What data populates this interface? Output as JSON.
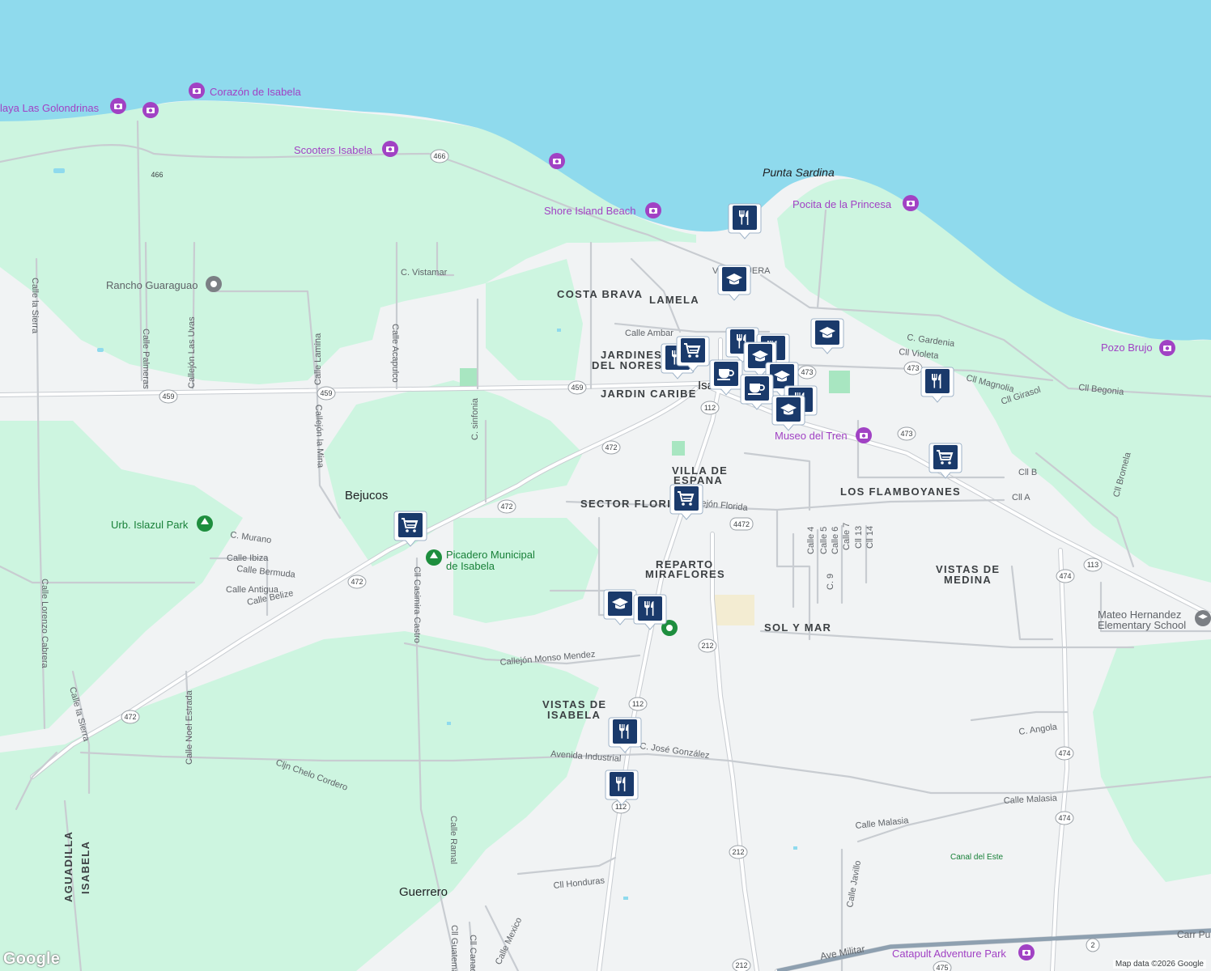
{
  "areas": [
    {
      "id": "costa-brava",
      "text": "COSTA BRAVA"
    },
    {
      "id": "lamela",
      "text": "LAMELA"
    },
    {
      "id": "jardines-1",
      "text": "JARDINES"
    },
    {
      "id": "jardines-2",
      "text": "DEL NOREST"
    },
    {
      "id": "jardin-caribe",
      "text": "JARDIN CARIBE"
    },
    {
      "id": "villa-espana-1",
      "text": "VILLA DE"
    },
    {
      "id": "villa-espana-2",
      "text": "ESPANA"
    },
    {
      "id": "sector-florida",
      "text": "SECTOR FLORID"
    },
    {
      "id": "los-flamboyanes",
      "text": "LOS FLAMBOYANES"
    },
    {
      "id": "reparto-1",
      "text": "REPARTO"
    },
    {
      "id": "reparto-2",
      "text": "MIRAFLORES"
    },
    {
      "id": "sol-y-mar",
      "text": "SOL Y MAR"
    },
    {
      "id": "vistas-medina-1",
      "text": "VISTAS DE"
    },
    {
      "id": "vistas-medina-2",
      "text": "MEDINA"
    },
    {
      "id": "vistas-isabela-1",
      "text": "VISTAS DE"
    },
    {
      "id": "vistas-isabela-2",
      "text": "ISABELA"
    },
    {
      "id": "isabela-town",
      "text": "Isa"
    },
    {
      "id": "bejucos",
      "text": "Bejucos"
    },
    {
      "id": "guerrero",
      "text": "Guerrero"
    },
    {
      "id": "punta-sardina",
      "text": "Punta Sardina"
    },
    {
      "id": "aguadilla",
      "text": "AGUADILLA"
    },
    {
      "id": "isabela-border",
      "text": "ISABELA"
    }
  ],
  "pois": [
    {
      "id": "golondrinas",
      "text": "laya Las Golondrinas"
    },
    {
      "id": "corazon",
      "text": "Corazón de Isabela"
    },
    {
      "id": "scooters",
      "text": "Scooters Isabela"
    },
    {
      "id": "shore-island",
      "text": "Shore Island Beach"
    },
    {
      "id": "pocita",
      "text": "Pocita de la Princesa"
    },
    {
      "id": "pozo-brujo",
      "text": "Pozo Brujo"
    },
    {
      "id": "museo",
      "text": "Museo del Tren"
    },
    {
      "id": "rancho",
      "text": "Rancho Guaraguao"
    },
    {
      "id": "islazul",
      "text": "Urb. Islazul Park"
    },
    {
      "id": "picadero-1",
      "text": "Picadero Municipal"
    },
    {
      "id": "picadero-2",
      "text": "de Isabela"
    },
    {
      "id": "mateo-1",
      "text": "Mateo Hernandez"
    },
    {
      "id": "mateo-2",
      "text": "Elementary School"
    },
    {
      "id": "catapult",
      "text": "Catapult Adventure Park"
    }
  ],
  "streets": [
    {
      "id": "vistamar",
      "text": "C. Vistamar"
    },
    {
      "id": "ambar",
      "text": "Calle Ambar"
    },
    {
      "id": "pesquera",
      "text": "V    PESQUERA"
    },
    {
      "id": "gardenia",
      "text": "C. Gardenia"
    },
    {
      "id": "violeta",
      "text": "Cll Violeta"
    },
    {
      "id": "magnolia",
      "text": "Cll Magnolia"
    },
    {
      "id": "girasol",
      "text": "Cll Girasol"
    },
    {
      "id": "begonia",
      "text": "Cll Begonia"
    },
    {
      "id": "cll-b",
      "text": "Cll B"
    },
    {
      "id": "cll-a",
      "text": "Cll A"
    },
    {
      "id": "bromela",
      "text": "Cll Bromela"
    },
    {
      "id": "callejon-florida",
      "text": "ejón Florida"
    },
    {
      "id": "calle4",
      "text": "Calle 4"
    },
    {
      "id": "calle5",
      "text": "Calle 5"
    },
    {
      "id": "calle6",
      "text": "Calle 6"
    },
    {
      "id": "calle7",
      "text": "Calle 7"
    },
    {
      "id": "cll13",
      "text": "Cll 13"
    },
    {
      "id": "cll14",
      "text": "Cll 14"
    },
    {
      "id": "c9",
      "text": "C. 9"
    },
    {
      "id": "sierra-1",
      "text": "Calle la Sierra"
    },
    {
      "id": "palmeras",
      "text": "Calle Palmeras"
    },
    {
      "id": "las-uvas",
      "text": "Callejón Las Uvas"
    },
    {
      "id": "lamina",
      "text": "Calle Lamina"
    },
    {
      "id": "acapulco",
      "text": "Calle Acapulco"
    },
    {
      "id": "la-mina",
      "text": "Callejón la Mina"
    },
    {
      "id": "sinfonia",
      "text": "C. sinfonia"
    },
    {
      "id": "murano",
      "text": "C. Murano"
    },
    {
      "id": "ibiza",
      "text": "Calle Ibiza"
    },
    {
      "id": "bermuda",
      "text": "Calle Bermuda"
    },
    {
      "id": "antigua",
      "text": "Calle Antigua"
    },
    {
      "id": "belize",
      "text": "Calle Belize"
    },
    {
      "id": "casimira",
      "text": "Cll Casimira Castro"
    },
    {
      "id": "lorenzo",
      "text": "Calle Lorenzo Cabrera"
    },
    {
      "id": "sierra-2",
      "text": "Calle la Sierra"
    },
    {
      "id": "noel",
      "text": "Calle Noel Estrada"
    },
    {
      "id": "chelo",
      "text": "Cljn Chelo Cordero"
    },
    {
      "id": "monso",
      "text": "Callejón Monso Mendez"
    },
    {
      "id": "industrial",
      "text": "Avenida Industrial"
    },
    {
      "id": "jose-gonzalez",
      "text": "C. José González"
    },
    {
      "id": "angola",
      "text": "C. Angola"
    },
    {
      "id": "malasia-1",
      "text": "Calle Malasia"
    },
    {
      "id": "malasia-2",
      "text": "Calle Malasia"
    },
    {
      "id": "canal",
      "text": "Canal del Este"
    },
    {
      "id": "javillo",
      "text": "Calle Javillo"
    },
    {
      "id": "ramal",
      "text": "Calle Ramal"
    },
    {
      "id": "honduras",
      "text": "Cll Honduras"
    },
    {
      "id": "mexico",
      "text": "Calle Mexico"
    },
    {
      "id": "guatemala",
      "text": "Cll Guatema"
    },
    {
      "id": "canada",
      "text": "Cll Canada"
    },
    {
      "id": "militar",
      "text": "Ave Militar"
    },
    {
      "id": "carr",
      "text": "Carr Pu"
    }
  ],
  "shields": [
    {
      "id": "r466a",
      "text": "466"
    },
    {
      "id": "r466b",
      "text": "466"
    },
    {
      "id": "r459a",
      "text": "459"
    },
    {
      "id": "r459b",
      "text": "459"
    },
    {
      "id": "r459c",
      "text": "459"
    },
    {
      "id": "r112a",
      "text": "112"
    },
    {
      "id": "r112b",
      "text": "112"
    },
    {
      "id": "r112c",
      "text": "112"
    },
    {
      "id": "r473a",
      "text": "473"
    },
    {
      "id": "r473b",
      "text": "473"
    },
    {
      "id": "r473c",
      "text": "473"
    },
    {
      "id": "r472a",
      "text": "472"
    },
    {
      "id": "r472b",
      "text": "472"
    },
    {
      "id": "r472c",
      "text": "472"
    },
    {
      "id": "r472d",
      "text": "472"
    },
    {
      "id": "r4472",
      "text": "4472"
    },
    {
      "id": "r212a",
      "text": "212"
    },
    {
      "id": "r212b",
      "text": "212"
    },
    {
      "id": "r212c",
      "text": "212"
    },
    {
      "id": "r113",
      "text": "113"
    },
    {
      "id": "r474a",
      "text": "474"
    },
    {
      "id": "r474b",
      "text": "474"
    },
    {
      "id": "r474c",
      "text": "474"
    },
    {
      "id": "r475",
      "text": "475"
    },
    {
      "id": "r2",
      "text": "2"
    }
  ],
  "markers": [
    {
      "id": "m1",
      "icon": "restaurant-icon"
    },
    {
      "id": "m2",
      "icon": "school-icon"
    },
    {
      "id": "m3",
      "icon": "restaurant-icon"
    },
    {
      "id": "m4",
      "icon": "shopping-cart-icon"
    },
    {
      "id": "m5",
      "icon": "restaurant-icon"
    },
    {
      "id": "m6",
      "icon": "restaurant-icon"
    },
    {
      "id": "m7",
      "icon": "school-icon"
    },
    {
      "id": "m8",
      "icon": "coffee-icon"
    },
    {
      "id": "m9",
      "icon": "school-icon"
    },
    {
      "id": "m10",
      "icon": "coffee-icon"
    },
    {
      "id": "m11",
      "icon": "restaurant-icon"
    },
    {
      "id": "m12",
      "icon": "school-icon"
    },
    {
      "id": "m13",
      "icon": "school-icon"
    },
    {
      "id": "m14",
      "icon": "restaurant-icon"
    },
    {
      "id": "m15",
      "icon": "shopping-cart-icon"
    },
    {
      "id": "m16",
      "icon": "shopping-cart-icon"
    },
    {
      "id": "m17",
      "icon": "shopping-cart-icon"
    },
    {
      "id": "m18",
      "icon": "school-icon"
    },
    {
      "id": "m19",
      "icon": "restaurant-icon"
    },
    {
      "id": "m20",
      "icon": "restaurant-icon"
    },
    {
      "id": "m21",
      "icon": "restaurant-icon"
    }
  ],
  "colors": {
    "water": "#8fdaed",
    "land": "#f1f3f4",
    "green": "#cdf5e0",
    "road": "#ffffff",
    "road_outline": "#c6cbd1",
    "marker_fill": "#1a3a6b",
    "poi_purple": "#a142c4"
  },
  "attribution": "Map data ©2026 Google",
  "logo": "Google"
}
